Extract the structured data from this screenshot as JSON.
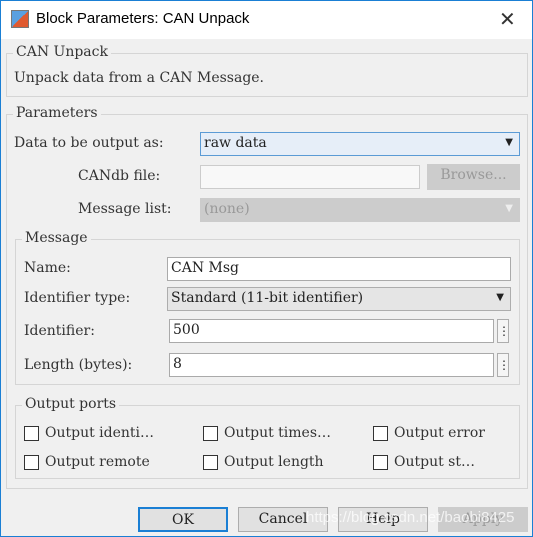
{
  "window": {
    "title": "Block Parameters: CAN Unpack"
  },
  "description": {
    "group_label": "CAN Unpack",
    "text": "Unpack data from a CAN Message."
  },
  "parameters": {
    "group_label": "Parameters",
    "output_as_label": "Data to be output as:",
    "output_as_value": "raw data",
    "candb_label": "CANdb file:",
    "candb_value": "",
    "browse_label": "Browse...",
    "message_list_label": "Message list:",
    "message_list_value": "(none)",
    "message": {
      "group_label": "Message",
      "name_label": "Name:",
      "name_value": "CAN Msg",
      "id_type_label": "Identifier type:",
      "id_type_value": "Standard (11-bit identifier)",
      "identifier_label": "Identifier:",
      "identifier_value": "500",
      "length_label": "Length (bytes):",
      "length_value": "8"
    },
    "output_ports": {
      "group_label": "Output ports",
      "items": [
        {
          "label": "Output identi…",
          "checked": false
        },
        {
          "label": "Output times…",
          "checked": false
        },
        {
          "label": "Output error",
          "checked": false
        },
        {
          "label": "Output remote",
          "checked": false
        },
        {
          "label": "Output length",
          "checked": false
        },
        {
          "label": "Output st…",
          "checked": false
        }
      ]
    }
  },
  "buttons": {
    "ok": "OK",
    "cancel": "Cancel",
    "help": "Help",
    "apply": "Apply"
  },
  "watermark": "https://blog.csdn.net/baobi8425"
}
